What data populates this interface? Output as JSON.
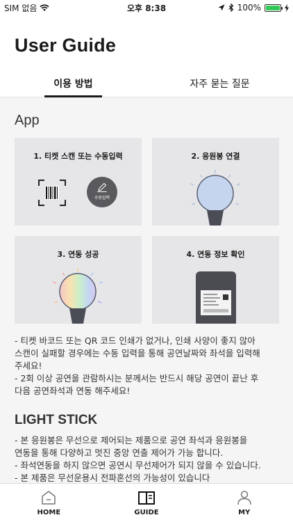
{
  "status_bar": {
    "carrier": "SIM 없음",
    "time": "오후 8:38",
    "battery": "100%",
    "battery_level": 1.0
  },
  "header": {
    "title": "User Guide",
    "tabs": [
      {
        "label": "이용 방법",
        "active": true
      },
      {
        "label": "자주 묻는 질문",
        "active": false
      }
    ]
  },
  "app_section": {
    "title": "App",
    "cards": [
      {
        "title": "1. 티켓 스캔 또는 수동입력",
        "sub_label": "수동입력"
      },
      {
        "title": "2. 응원봉 연결"
      },
      {
        "title": "3. 연동 성공"
      },
      {
        "title": "4. 연동 정보 확인"
      }
    ],
    "description": [
      "- 티켓 바코드 또는 QR 코드 인쇄가 없거나, 인쇄 사양이 좋지 않아",
      "스캔이 실패할 경우에는 수동 입력을 통해 공연날짜와 좌석을 입력해",
      "주세요!",
      "- 2회 이상 공연을 관람하시는 분께서는 반드시 해당 공연이 끝난 후",
      "다음 공연좌석과 연동 해주세요!"
    ]
  },
  "lightstick_section": {
    "title": "LIGHT STICK",
    "description": [
      "- 본 응원봉은 무선으로 제어되는 제품으로 공연 좌석과 응원봉을",
      "연동을 통해 다양하고 멋진 중앙 연출 제어가 가능 합니다.",
      "- 좌석연동을 하지 않으면 공연시 무선제어가 되지 않을 수 있습니다.",
      "- 본 제품은 무선운용시 전파혼선의 가능성이 있습니다"
    ]
  },
  "tabbar": {
    "items": [
      {
        "label": "HOME",
        "icon": "home-icon"
      },
      {
        "label": "GUIDE",
        "icon": "guide-book-icon"
      },
      {
        "label": "MY",
        "icon": "person-icon"
      }
    ]
  }
}
